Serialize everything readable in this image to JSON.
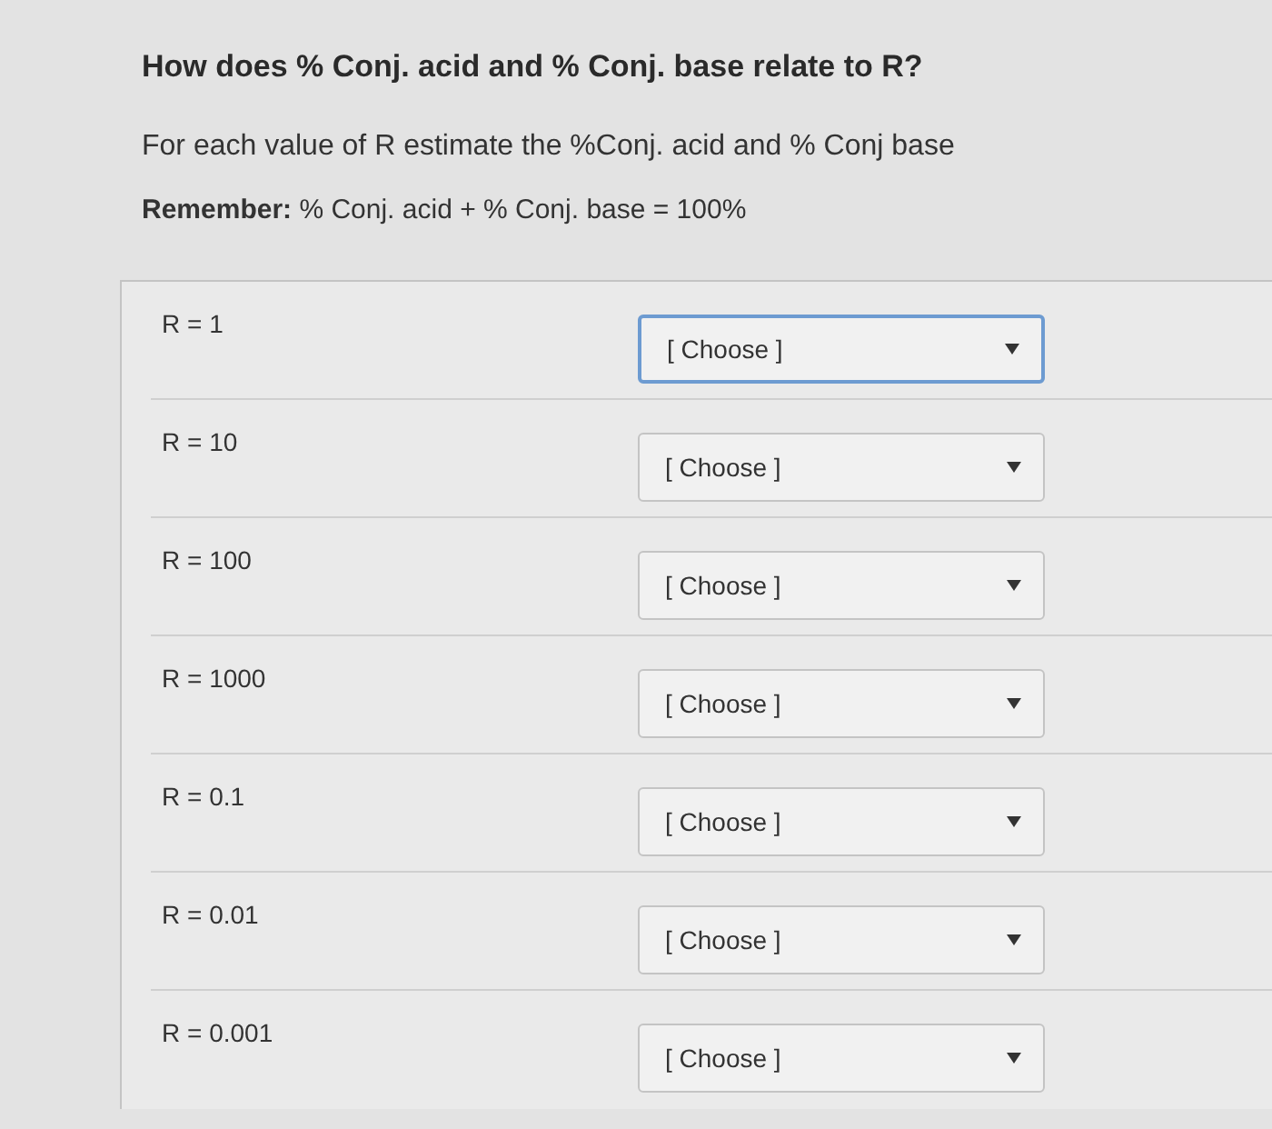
{
  "question": {
    "title": "How does % Conj. acid and % Conj. base relate to R?",
    "instruction": "For each value of R estimate the %Conj. acid and % Conj base",
    "reminder": "**Remember:** % Conj. acid + % Conj. base = 100%"
  },
  "rows": [
    {
      "label": "R = 1",
      "select": {
        "value": "[ Choose ]",
        "focused": true
      }
    },
    {
      "label": "R = 10",
      "select": {
        "value": "[ Choose ]",
        "focused": false
      }
    },
    {
      "label": "R = 100",
      "select": {
        "value": "[ Choose ]",
        "focused": false
      }
    },
    {
      "label": "R = 1000",
      "select": {
        "value": "[ Choose ]",
        "focused": false
      }
    },
    {
      "label": "R = 0.1",
      "select": {
        "value": "[ Choose ]",
        "focused": false
      }
    },
    {
      "label": "R = 0.01",
      "select": {
        "value": "[ Choose ]",
        "focused": false
      }
    },
    {
      "label": "R = 0.001",
      "select": {
        "value": "[ Choose ]",
        "focused": false
      }
    }
  ]
}
